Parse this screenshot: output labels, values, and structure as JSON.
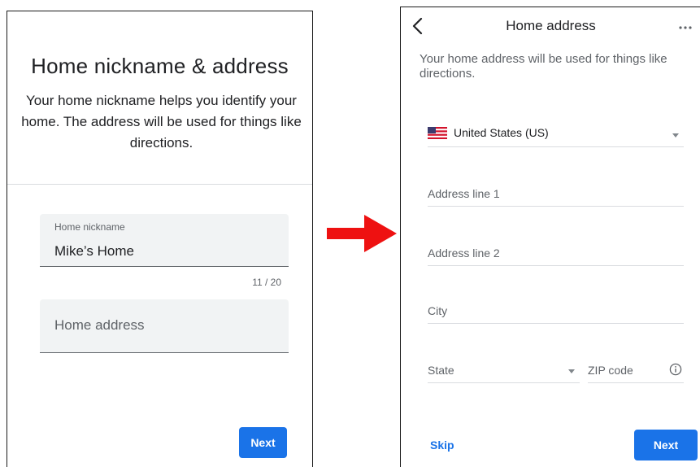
{
  "left_screen": {
    "title": "Home nickname & address",
    "description": "Your home nickname helps you identify your home. The address will be used for things like directions.",
    "nickname_field": {
      "label": "Home nickname",
      "value": "Mike’s Home"
    },
    "nickname_counter": "11 / 20",
    "address_field": {
      "placeholder": "Home address"
    },
    "next_label": "Next",
    "accent_color": "#1a73e8"
  },
  "arrow": {
    "color": "#ee1111",
    "icon": "right-arrow-icon"
  },
  "right_screen": {
    "title": "Home address",
    "description": "Your home address will be used for things like directions.",
    "country": {
      "flag_icon": "us-flag-icon",
      "value": "United States (US)"
    },
    "address_line_1": {
      "placeholder": "Address line 1"
    },
    "address_line_2": {
      "placeholder": "Address line 2"
    },
    "city": {
      "placeholder": "City"
    },
    "state": {
      "placeholder": "State"
    },
    "zip": {
      "placeholder": "ZIP code"
    },
    "skip_label": "Skip",
    "next_label": "Next"
  }
}
